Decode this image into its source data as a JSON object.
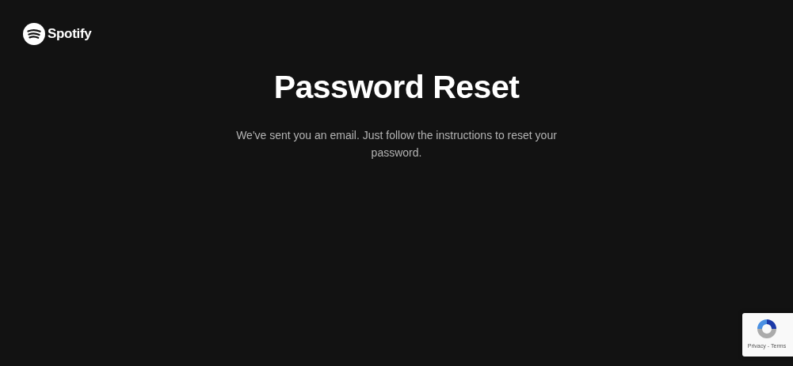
{
  "logo": {
    "text": "Spotify"
  },
  "title": "Password Reset",
  "message": "We've sent you an email. Just follow the instructions to reset your password.",
  "recaptcha": {
    "links": [
      "Privacy",
      "Terms"
    ],
    "separator": "-"
  }
}
